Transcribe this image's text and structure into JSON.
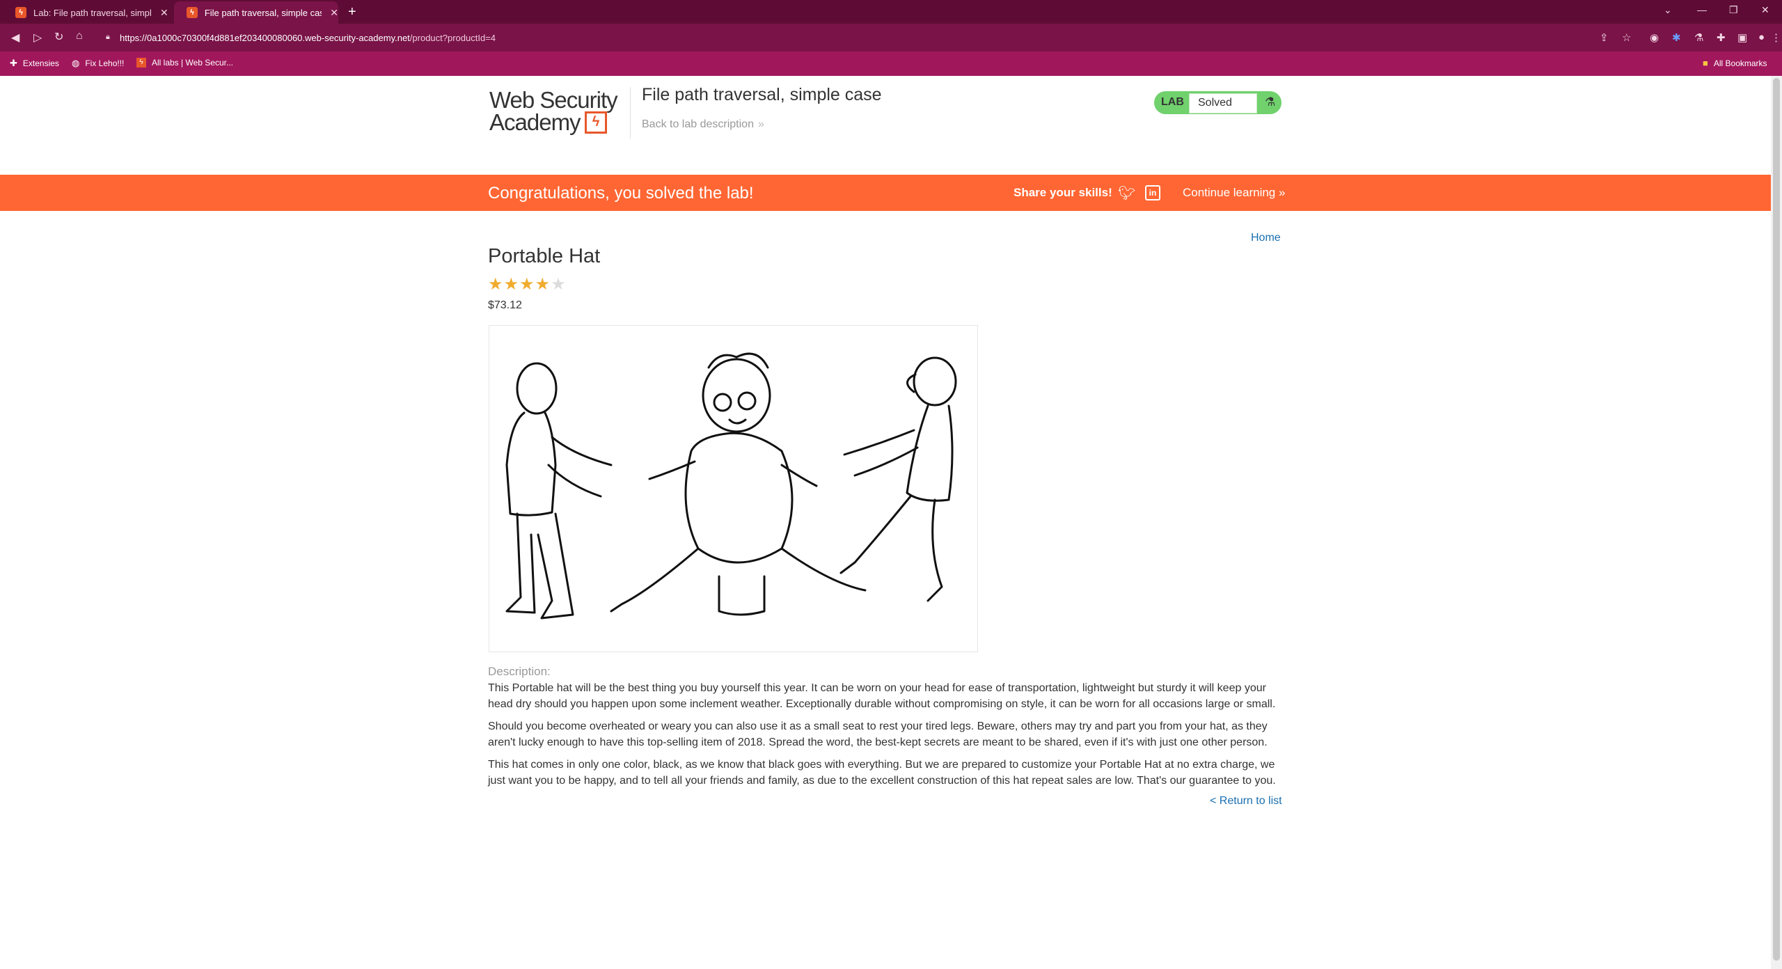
{
  "browser": {
    "tabs": [
      {
        "label": "Lab: File path traversal, simple c",
        "active": false
      },
      {
        "label": "File path traversal, simple case",
        "active": true
      }
    ],
    "url_host": "https://0a1000c70300f4d881ef203400080060.web-security-academy.net",
    "url_path": "/product?productId=4",
    "bookmarks": [
      {
        "label": "Extensies",
        "icon": "puzzle-icon"
      },
      {
        "label": "Fix Leho!!!",
        "icon": "globe-icon"
      },
      {
        "label": "All labs | Web Secur...",
        "icon": "academy-favicon"
      }
    ],
    "all_bookmarks": "All Bookmarks"
  },
  "header": {
    "logo_line1": "Web Security",
    "logo_line2": "Academy",
    "lab_title": "File path traversal, simple case",
    "back_link": "Back to lab description",
    "status_tag": "LAB",
    "status_value": "Solved",
    "status_color": "#70d16d"
  },
  "banner": {
    "congrats": "Congratulations, you solved the lab!",
    "share": "Share your skills!",
    "continue": "Continue learning",
    "color": "#ff6633"
  },
  "product": {
    "home_link": "Home",
    "title": "Portable Hat",
    "rating": 4,
    "rating_max": 5,
    "price": "$73.12",
    "description_label": "Description:",
    "paragraphs": [
      "This Portable hat will be the best thing you buy yourself this year. It can be worn on your head for ease of transportation, lightweight but sturdy it will keep your head dry should you happen upon some inclement weather. Exceptionally durable without compromising on style, it can be worn for all occasions large or small.",
      "Should you become overheated or weary you can also use it as a small seat to rest your tired legs. Beware, others may try and part you from your hat, as they aren't lucky enough to have this top-selling item of 2018. Spread the word, the best-kept secrets are meant to be shared, even if it's with just one other person.",
      "This hat comes in only one color, black, as we know that black goes with everything. But we are prepared to customize your Portable Hat at no extra charge, we just want you to be happy, and to tell all your friends and family, as due to the excellent construction of this hat repeat sales are low. That's our guarantee to you."
    ],
    "return_link": "< Return to list"
  }
}
